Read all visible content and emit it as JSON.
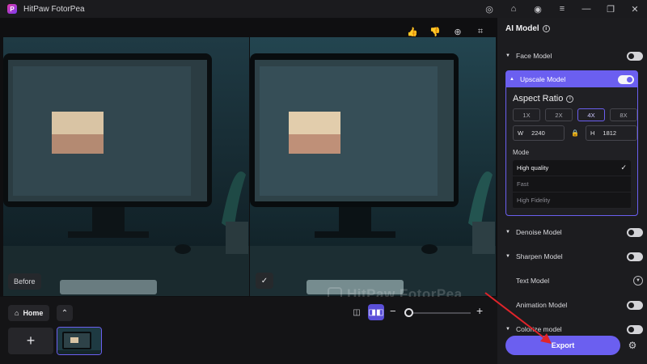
{
  "app": {
    "title": "HitPaw FotorPea",
    "logo_letter": "P"
  },
  "titlebar": {
    "icons": [
      "discord-icon",
      "gift-icon",
      "account-icon",
      "menu-icon",
      "minimize-icon",
      "restore-icon",
      "close-icon"
    ],
    "glyphs": [
      "◎",
      "⌂",
      "◉",
      "≡",
      "—",
      "❐",
      "✕"
    ]
  },
  "canvas": {
    "tools": [
      "thumbs-up-icon",
      "thumbs-down-icon",
      "zoom-in-icon",
      "crop-icon"
    ],
    "tool_glyphs": [
      "👍",
      "👎",
      "⊕",
      "⌗"
    ],
    "before_label": "Before",
    "after_check": "✓",
    "watermark": "HitPaw FotorPea"
  },
  "bottom": {
    "home_label": "Home",
    "home_glyph": "⌂",
    "up_glyph": "⌃",
    "single_view_glyph": "◫",
    "split_view_glyph": "◨◧",
    "zoom_minus": "−",
    "zoom_plus": "+",
    "zoom_level": 0,
    "add_glyph": "+"
  },
  "panel": {
    "title": "AI Model",
    "info_glyph": "i",
    "models": [
      {
        "label": "Face Model",
        "control": "toggle",
        "on": false
      },
      {
        "label": "Upscale Model",
        "control": "toggle",
        "on": true,
        "expanded": true
      },
      {
        "label": "Denoise Model",
        "control": "toggle",
        "on": false
      },
      {
        "label": "Sharpen Model",
        "control": "toggle",
        "on": false
      },
      {
        "label": "Text Model",
        "control": "chevron",
        "on": false
      },
      {
        "label": "Animation Model",
        "control": "toggle",
        "on": false
      },
      {
        "label": "Colorize model",
        "control": "toggle",
        "on": false
      }
    ],
    "upscale": {
      "aspect_title": "Aspect Ratio",
      "ratios": [
        "1X",
        "2X",
        "4X",
        "8X"
      ],
      "active_ratio": "4X",
      "width_label": "W",
      "width_value": "2240",
      "height_label": "H",
      "height_value": "1812",
      "mode_label": "Mode",
      "modes": [
        "High quality",
        "Fast",
        "High Fidelity"
      ],
      "selected_mode": "High quality"
    },
    "export_label": "Export",
    "settings_glyph": "⚙"
  },
  "colors": {
    "accent": "#6b5ff0",
    "arrow": "#e0242a",
    "background": "#141416",
    "panel": "#1c1c1f"
  }
}
